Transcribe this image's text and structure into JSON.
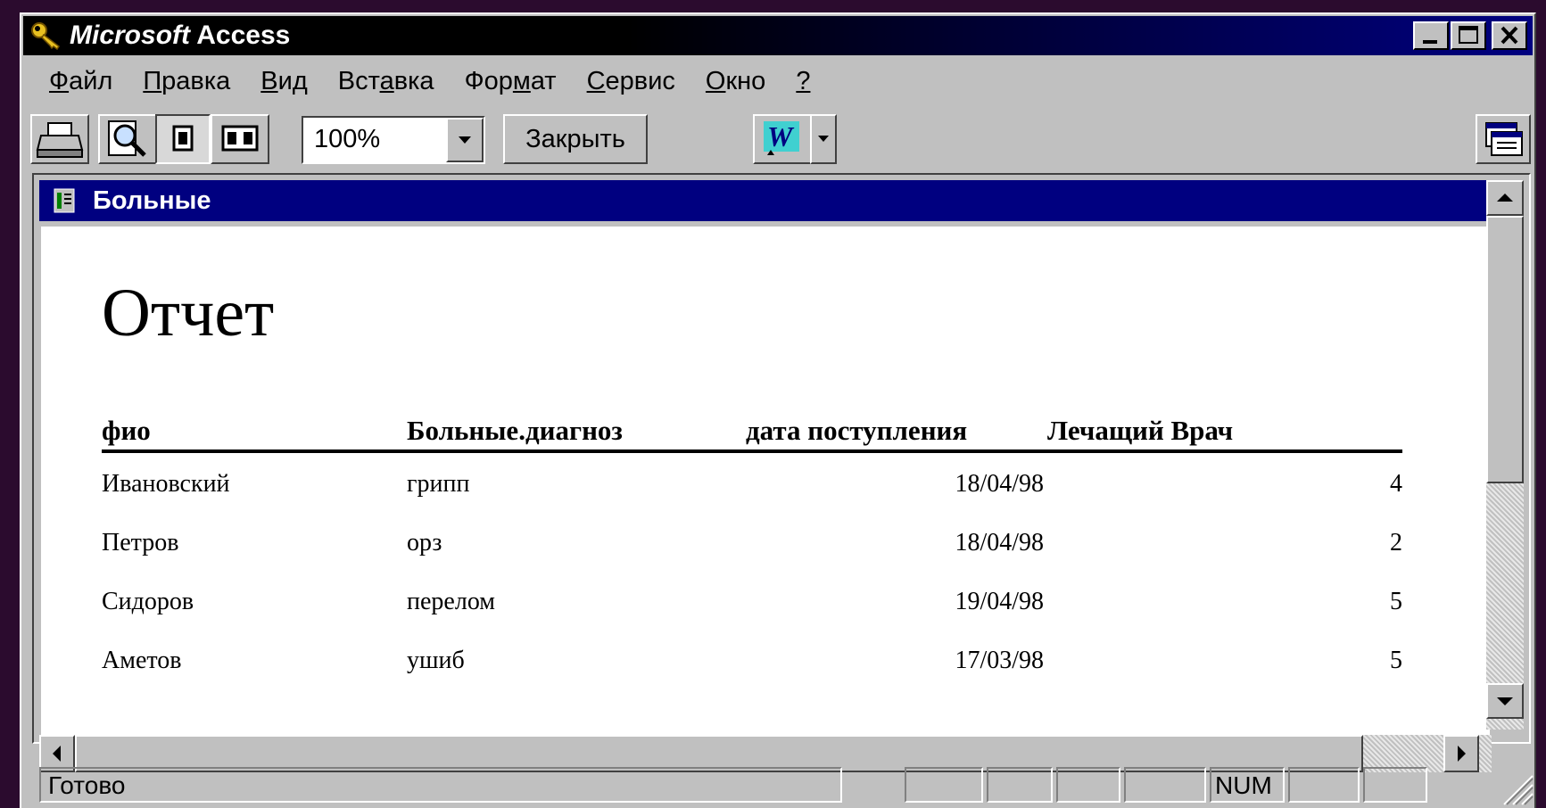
{
  "window": {
    "title_italic": "Microsoft",
    "title_rest": "Access"
  },
  "menu": {
    "items": [
      {
        "pre": "",
        "u": "Ф",
        "post": "айл"
      },
      {
        "pre": "",
        "u": "П",
        "post": "равка"
      },
      {
        "pre": "",
        "u": "В",
        "post": "ид"
      },
      {
        "pre": "Вст",
        "u": "а",
        "post": "вка"
      },
      {
        "pre": "Фор",
        "u": "м",
        "post": "ат"
      },
      {
        "pre": "",
        "u": "С",
        "post": "ервис"
      },
      {
        "pre": "",
        "u": "О",
        "post": "кно"
      },
      {
        "pre": "",
        "u": "?",
        "post": ""
      }
    ]
  },
  "toolbar": {
    "zoom_value": "100%",
    "close_label": "Закрыть"
  },
  "report_window": {
    "title": "Больные"
  },
  "report": {
    "title": "Отчет",
    "columns": [
      "фио",
      "Больные.диагноз",
      "дата поступления",
      "Лечащий Врач"
    ],
    "rows": [
      [
        "Ивановский",
        "грипп",
        "18/04/98",
        "4"
      ],
      [
        "Петров",
        "орз",
        "18/04/98",
        "2"
      ],
      [
        "Сидоров",
        "перелом",
        "19/04/98",
        "5"
      ],
      [
        "Аметов",
        "ушиб",
        "17/03/98",
        "5"
      ]
    ]
  },
  "statusbar": {
    "text": "Готово",
    "num": "NUM"
  }
}
